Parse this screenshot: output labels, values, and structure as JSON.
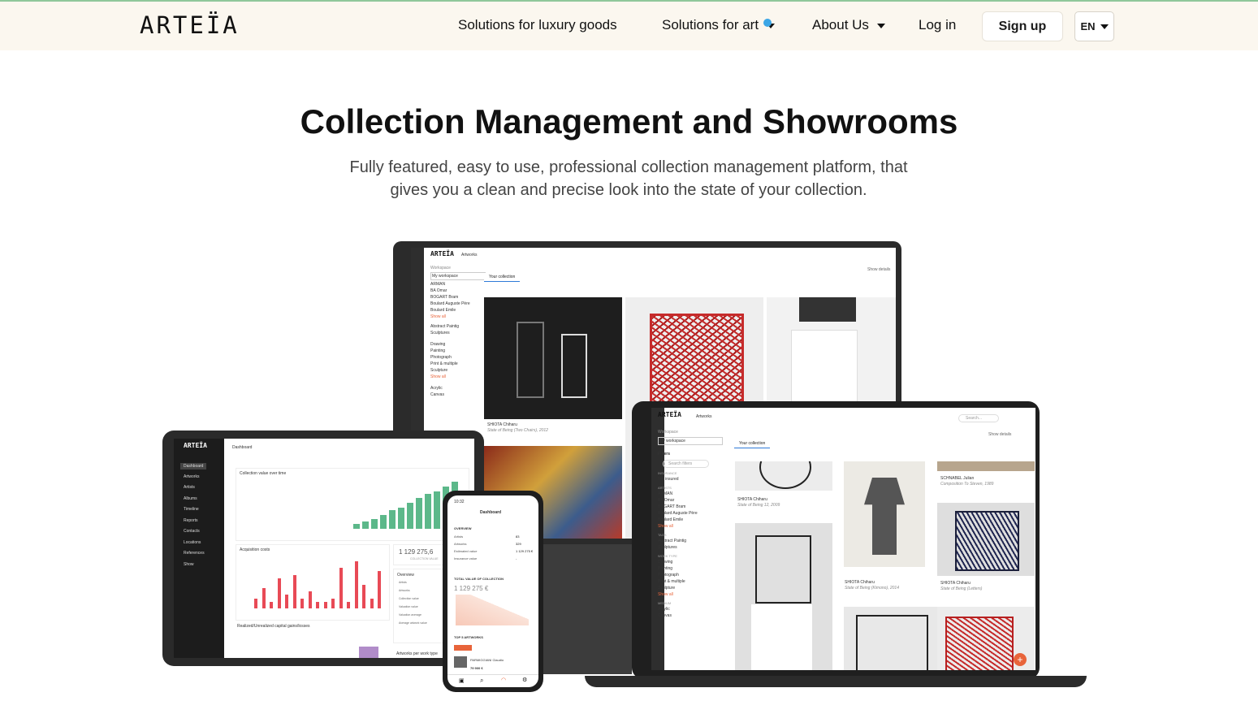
{
  "brand": {
    "logo": "ARTEÏA"
  },
  "nav": {
    "items": [
      {
        "label": "Solutions for luxury goods",
        "dropdown": false
      },
      {
        "label": "Solutions for art",
        "dropdown": true,
        "badge_dot": true
      },
      {
        "label": "About Us",
        "dropdown": true
      },
      {
        "label": "Log in",
        "dropdown": false
      }
    ],
    "signup_label": "Sign up",
    "language": "EN"
  },
  "hero": {
    "title": "Collection Management and Showrooms",
    "subtitle_line1": "Fully featured, easy to use, professional collection management platform, that",
    "subtitle_line2": "gives you a clean and precise look into the state of your collection."
  },
  "colors": {
    "header_bg": "#fbf7ef",
    "accent_dot": "#3ba6e6",
    "chart_green": "#5cb88a",
    "chart_red": "#e84a56",
    "top_line": "#8fc79a"
  },
  "mockups": {
    "monitor": {
      "logo": "ARTEÏA",
      "page": "Artworks",
      "workspace_label": "Workspace",
      "workspace_value": "My workspace",
      "tab": "Your collection",
      "show_details": "Show details",
      "artists": [
        "ARMAN",
        "BA Omar",
        "BOGART Bram",
        "Boulard Auguste Père",
        "Boulard Emile"
      ],
      "show_all": "Show all",
      "tags": [
        "Abstract Paintig",
        "Sculptures"
      ],
      "work_types": [
        "Drawing",
        "Painting",
        "Photograph",
        "Print & multiple",
        "Sculpture"
      ],
      "mediums": [
        "Acrylic",
        "Canvas"
      ],
      "caption_artist": "SHIOTA Chiharu",
      "caption_title": "State of Being (Two Chairs), 2012"
    },
    "tablet": {
      "logo": "ARTEÏA",
      "page": "Dashboard",
      "menu": [
        "Dashboard",
        "Artworks",
        "Artists",
        "Albums",
        "Timeline",
        "Reports",
        "Contacts",
        "Locations",
        "References",
        "Show"
      ],
      "chart1_title": "Collection value over time",
      "chart2_title": "Acquisition costs",
      "chart3_title": "Realized/Unrealized capital gains/losses",
      "value": "1 129 275,6",
      "value_caption": "COLLECTION VALUE",
      "overview_title": "Overview",
      "overview_rows": [
        "Artists",
        "Artworks",
        "Collection value",
        "Valuation value",
        "Valuation average",
        "Average artwork value"
      ],
      "bottom_title": "Artworks per work type",
      "green_bars": [
        2,
        3,
        4,
        6,
        8,
        9,
        11,
        13,
        15,
        16,
        18,
        20
      ],
      "red_bars": [
        3,
        6,
        2,
        9,
        4,
        10,
        3,
        5,
        2,
        2,
        3,
        12,
        2,
        14,
        7,
        3,
        11
      ]
    },
    "phone": {
      "time": "10:32",
      "page": "Dashboard",
      "overview": "OVERVIEW",
      "rows": [
        [
          "Artists",
          "83"
        ],
        [
          "Artworks",
          "329"
        ],
        [
          "Estimated value",
          "1 129 275 €"
        ],
        [
          "Insurance value",
          "-"
        ]
      ],
      "total_label": "TOTAL VALUE OF COLLECTION",
      "total_value": "1 129 275 €",
      "top_label": "TOP 5 ARTWORKS",
      "top_artist": "PARMIGGIANI Claudio",
      "top_value": "79 900 €"
    },
    "laptop": {
      "logo": "ARTEÏA",
      "page": "Artworks",
      "search": "Search...",
      "workspace_label": "Workspace",
      "workspace_value": "My workspace",
      "tab": "Your collection",
      "show_details": "Show details",
      "filters": "Filters",
      "search_filters": "Search filters",
      "insurance": "INSURANCE",
      "not_insured": "Not insured",
      "artists_label": "ARTISTS",
      "artists": [
        "ARMAN",
        "BA Omar",
        "BOGART Bram",
        "Boulard Auguste Père",
        "Boulard Emile"
      ],
      "tags_label": "TAGS",
      "tags": [
        "Abstract Paintig",
        "Sculptures"
      ],
      "work_type_label": "WORK TYPE",
      "work_types": [
        "Drawing",
        "Painting",
        "Photograph",
        "Print & multiple",
        "Sculpture"
      ],
      "medium_label": "MEDIUM",
      "mediums": [
        "Acrylic",
        "Canvas"
      ],
      "show_all": "Show all",
      "cards": [
        {
          "artist": "SHIOTA Chiharu",
          "title": "State of Being 12, 2009"
        },
        {
          "artist": "SHIOTA Chiharu",
          "title": "State of Being (Kimono), 2014"
        },
        {
          "artist": "SCHNABEL Julian",
          "title": "Composition To Steven, 1989"
        },
        {
          "artist": "SHIOTA Chiharu",
          "title": "State of Being (Letters)"
        }
      ]
    }
  }
}
